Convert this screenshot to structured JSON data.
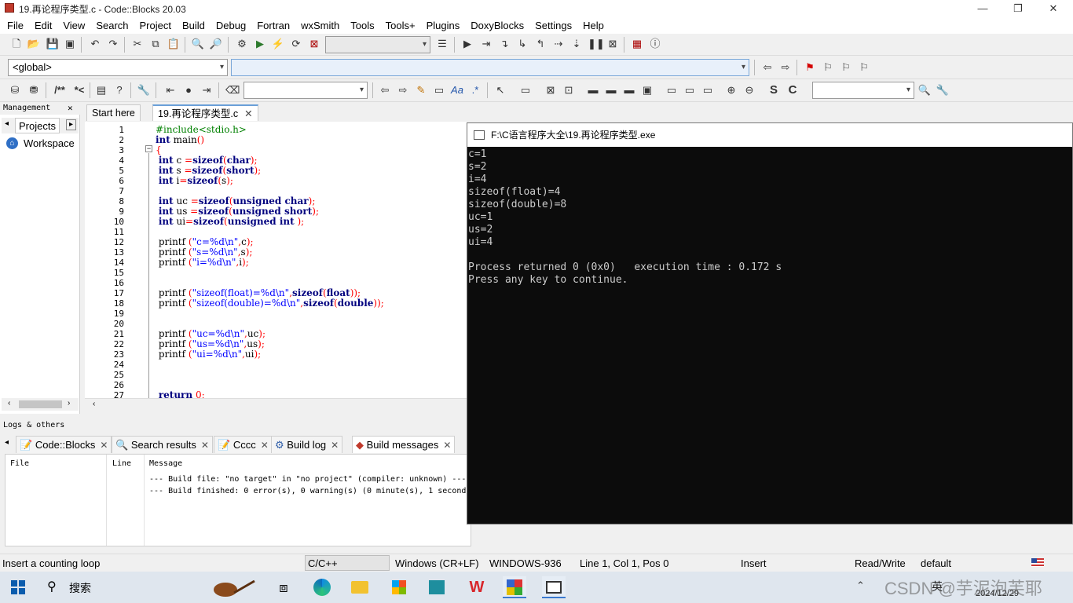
{
  "window": {
    "title": "19.再论程序类型.c - Code::Blocks 20.03",
    "controls": [
      "—",
      "❐",
      "✕"
    ]
  },
  "menu": [
    "File",
    "Edit",
    "View",
    "Search",
    "Project",
    "Build",
    "Debug",
    "Fortran",
    "wxSmith",
    "Tools",
    "Tools+",
    "Plugins",
    "DoxyBlocks",
    "Settings",
    "Help"
  ],
  "toolbar": {
    "scope_combo": "<global>",
    "function_combo": "",
    "search_combo": ""
  },
  "management": {
    "header": "Management",
    "tab_projects": "Projects",
    "workspace_label": "Workspace"
  },
  "editor": {
    "tabs": [
      "Start here",
      "19.再论程序类型.c"
    ],
    "line_numbers": [
      "1",
      "2",
      "3",
      "4",
      "5",
      "6",
      "7",
      "8",
      "9",
      "10",
      "11",
      "12",
      "13",
      "14",
      "15",
      "16",
      "17",
      "18",
      "19",
      "20",
      "21",
      "22",
      "23",
      "24",
      "25",
      "26",
      "27"
    ]
  },
  "logs": {
    "header": "Logs & others",
    "tabs": [
      "Code::Blocks",
      "Search results",
      "Cccc",
      "Build log",
      "Build messages"
    ],
    "columns": [
      "File",
      "Line",
      "Message"
    ],
    "messages": [
      "--- Build file: \"no target\" in \"no project\" (compiler: unknown) ---",
      "--- Build finished: 0 error(s), 0 warning(s) (0 minute(s), 1 second"
    ]
  },
  "console": {
    "title": "F:\\C语言程序大全\\19.再论程序类型.exe",
    "output": "c=1\ns=2\ni=4\nsizeof(float)=4\nsizeof(double)=8\nuc=1\nus=2\nui=4\n\nProcess returned 0 (0x0)   execution time : 0.172 s\nPress any key to continue."
  },
  "status": {
    "hint": "Insert a counting loop",
    "language": "C/C++",
    "eol": "Windows (CR+LF)",
    "encoding": "WINDOWS-936",
    "position": "Line 1, Col 1, Pos 0",
    "mode": "Insert",
    "access": "Read/Write",
    "profile": "default"
  },
  "taskbar": {
    "search_label": "搜索",
    "date": "2024/12/29",
    "ime": "英",
    "watermark": "CSDN @芋泥泡芙耶"
  }
}
